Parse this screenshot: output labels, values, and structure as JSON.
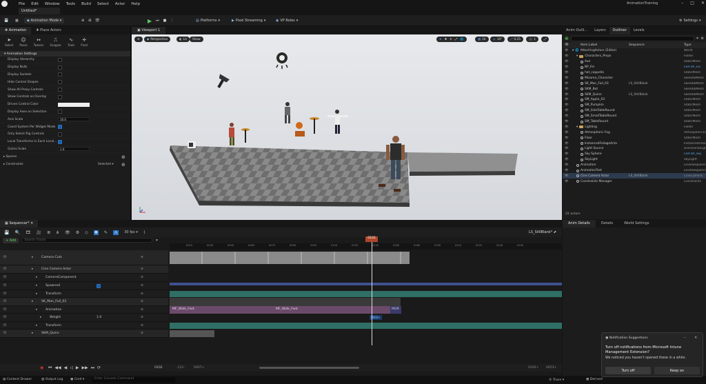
{
  "menubar": {
    "items": [
      "File",
      "Edit",
      "Window",
      "Tools",
      "Build",
      "Select",
      "Actor",
      "Help"
    ],
    "project": "AnimationTraining"
  },
  "doc_tab": "Untitled*",
  "toolbar": {
    "mode": "Animation Mode",
    "platforms": "Platforms",
    "pixel_streaming": "Pixel Streaming",
    "vp_roles": "VP Roles",
    "settings": "Settings"
  },
  "left_panel": {
    "tabs": [
      "Animation",
      "Place Actors"
    ],
    "modes": [
      "Select",
      "Poses",
      "Tweens",
      "Snapper",
      "Trails",
      "Pivot"
    ],
    "section": "Animation Settings",
    "rows": [
      {
        "label": "Display Hierarchy",
        "type": "check",
        "on": false
      },
      {
        "label": "Display Nulls",
        "type": "check",
        "on": false
      },
      {
        "label": "Display Sockets",
        "type": "check",
        "on": false
      },
      {
        "label": "Hide Control Shapes",
        "type": "check",
        "on": false
      },
      {
        "label": "Show All Proxy Controls",
        "type": "check",
        "on": false
      },
      {
        "label": "Show Controls as Overlay",
        "type": "check",
        "on": false
      },
      {
        "label": "Driven Control Color",
        "type": "color"
      },
      {
        "label": "Display Axes on Selection",
        "type": "check",
        "on": false
      },
      {
        "label": "Axis Scale",
        "type": "num",
        "value": "10.0"
      },
      {
        "label": "Coord System Per Widget Mode",
        "type": "check",
        "on": true
      },
      {
        "label": "Only Select Rig Controls",
        "type": "check",
        "on": false
      },
      {
        "label": "Local Transforms in Each Local...",
        "type": "check",
        "on": true
      },
      {
        "label": "Gizmo Scale",
        "type": "num",
        "value": "1.0"
      }
    ],
    "spaces": "Spaces",
    "constraints": "Constraints",
    "constraints_value": "Selected"
  },
  "viewport": {
    "tab": "Viewport 1",
    "perspective": "Perspective",
    "lit": "Lit",
    "show": "Show",
    "grid_snap": "10",
    "rot_snap": "10°",
    "scale_snap": "0.25",
    "cam_speed": "1"
  },
  "outliner": {
    "tabs": [
      "Anim Outli...",
      "Layers",
      "Outliner",
      "Levels"
    ],
    "col_label": "Item Label",
    "col_sequence": "Sequence",
    "col_type": "Type",
    "items": [
      {
        "name": "AttachingActors (Editor)",
        "type": "World",
        "indent": 0,
        "kind": "world"
      },
      {
        "name": "Characters_Props",
        "type": "Folder",
        "indent": 1,
        "kind": "folder"
      },
      {
        "name": "Axe",
        "type": "StaticMesh",
        "indent": 2,
        "kind": "actor"
      },
      {
        "name": "BP_Fei",
        "type": "Edit BP_Fei",
        "indent": 2,
        "kind": "actor",
        "link": true
      },
      {
        "name": "hat_cappello",
        "type": "StaticMesh",
        "indent": 2,
        "kind": "actor"
      },
      {
        "name": "Mixamo_Character",
        "type": "SkeletalMesh",
        "indent": 2,
        "kind": "actor"
      },
      {
        "name": "SK_Man_Full_03",
        "seq": "LS_StillBlank",
        "type": "SkeletalMesh",
        "indent": 2,
        "kind": "actor"
      },
      {
        "name": "SKM_Bot",
        "type": "SkeletalMesh",
        "indent": 2,
        "kind": "actor"
      },
      {
        "name": "SKM_Quinn",
        "seq": "LS_StillBlank",
        "type": "SkeletalMesh",
        "indent": 2,
        "kind": "actor"
      },
      {
        "name": "SM_Apple_03",
        "type": "StaticMesh",
        "indent": 2,
        "kind": "actor"
      },
      {
        "name": "SM_Pumpkin",
        "type": "StaticMesh",
        "indent": 2,
        "kind": "actor"
      },
      {
        "name": "SM_SideTableRound",
        "type": "StaticMesh",
        "indent": 2,
        "kind": "actor"
      },
      {
        "name": "SM_SmallTableRound",
        "type": "StaticMesh",
        "indent": 2,
        "kind": "actor"
      },
      {
        "name": "SM_TableRound",
        "type": "StaticMesh",
        "indent": 2,
        "kind": "actor"
      },
      {
        "name": "Lighting",
        "type": "Folder",
        "indent": 1,
        "kind": "folder"
      },
      {
        "name": "Atmospheric Fog",
        "type": "AtmosphericFog",
        "indent": 2,
        "kind": "actor"
      },
      {
        "name": "Floor",
        "type": "StaticMesh",
        "indent": 2,
        "kind": "actor"
      },
      {
        "name": "InstancedFoliageActo",
        "type": "InstancedFoliage",
        "indent": 2,
        "kind": "actor"
      },
      {
        "name": "Light Source",
        "type": "DirectionalLight",
        "indent": 2,
        "kind": "actor"
      },
      {
        "name": "Sky Sphere",
        "type": "Edit BP_Sky",
        "indent": 2,
        "kind": "actor",
        "link": true
      },
      {
        "name": "SkyLight",
        "type": "SkyLight",
        "indent": 2,
        "kind": "actor"
      },
      {
        "name": "Animation",
        "type": "LevelSequence",
        "indent": 1,
        "kind": "actor"
      },
      {
        "name": "AnimationTest",
        "type": "LevelSequence",
        "indent": 1,
        "kind": "actor"
      },
      {
        "name": "Cine Camera Actor",
        "seq": "LS_StillBlank",
        "type": "CineCamera",
        "indent": 1,
        "kind": "actor",
        "selected": true
      },
      {
        "name": "Constraints Manager",
        "type": "Constraints",
        "indent": 1,
        "kind": "actor"
      }
    ],
    "count": "22 actors"
  },
  "details_tabs": [
    "Anim Details",
    "Details",
    "World Settings"
  ],
  "sequencer": {
    "tab": "Sequencer*",
    "fps": "30 fps",
    "sequence_name": "LS_StillBlank*",
    "add": "+ Add",
    "search_placeholder": "Search Tracks",
    "playhead": "0102",
    "tracks": [
      {
        "label": "Camera Cuts",
        "indent": 0,
        "h": 22
      },
      {
        "label": "Cine Camera Actor",
        "indent": 0,
        "h": 12
      },
      {
        "label": "CameraComponent",
        "indent": 1,
        "h": 12
      },
      {
        "label": "Spawned",
        "indent": 1,
        "h": 12,
        "check": true
      },
      {
        "label": "Transform",
        "indent": 1,
        "h": 11
      },
      {
        "label": "SK_Man_Full_03",
        "indent": 0,
        "h": 12
      },
      {
        "label": "Animation",
        "indent": 1,
        "h": 11
      },
      {
        "label": "Weight",
        "indent": 2,
        "h": 12,
        "value": "1.0"
      },
      {
        "label": "Transform",
        "indent": 1,
        "h": 11
      },
      {
        "label": "SKM_Quinn",
        "indent": 0,
        "h": 12
      }
    ],
    "ruler_ticks": [
      "0015",
      "0030",
      "0045",
      "0060",
      "0075",
      "0090",
      "0105",
      "0120",
      "0135",
      "0150",
      "0165",
      "0180",
      "0195",
      "0210",
      "0225",
      "0240",
      "0255"
    ],
    "clip1": "MF_Walk_Fwd",
    "clip2": "MF_Walk_Fwd",
    "clip3": "MOR",
    "key_label": "0002+",
    "current_frame": "0102",
    "range_start": "-121-",
    "range_start2": "0007+",
    "range_end": "0192+",
    "range_end2": "0653+"
  },
  "statusbar": {
    "content_drawer": "Content Drawer",
    "output_log": "Output Log",
    "cmd": "Cmd",
    "console_placeholder": "Enter Console Command",
    "trace": "Trace",
    "derived": "Derived"
  },
  "notification": {
    "title": "Notification Suggestions",
    "heading": "Turn off notifications from Microsoft Intune Management Extension?",
    "body": "We noticed you haven't opened these in a while.",
    "btn_off": "Turn off",
    "btn_keep": "Keep on"
  }
}
